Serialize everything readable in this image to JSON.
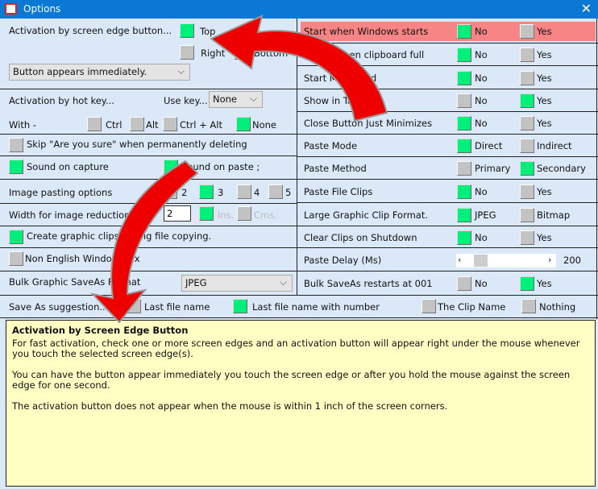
{
  "window": {
    "title": "Options",
    "close": "✕"
  },
  "left": {
    "edge": {
      "label": "Activation by screen edge button...",
      "top": "Top",
      "right": "Right",
      "bottom": "Bottom",
      "dropdown": "Button appears immediately."
    },
    "hotkey": {
      "label": "Activation by hot key...",
      "use_key": "Use key...",
      "key_value": "None",
      "with": "With  -",
      "ctrl": "Ctrl",
      "alt": "Alt",
      "ctrl_alt": "Ctrl + Alt",
      "none": "None"
    },
    "skip": "Skip \"Are you sure\" when permanently deleting",
    "sound_capture": "Sound on capture",
    "sound_paste": "Sound on paste ;",
    "image_paste": {
      "label": "Image pasting options",
      "opts": [
        "2",
        "3",
        "4",
        "5"
      ]
    },
    "width": {
      "label": "Width for image reduction",
      "value": "2",
      "ins": "Ins.",
      "cms": "Cms."
    },
    "create_graphic": "Create graphic clips during file copying.",
    "non_english": "Non English Windows Fix",
    "bulk": {
      "label": "Bulk Graphic SaveAs Format",
      "value": "JPEG"
    }
  },
  "right": [
    {
      "label": "Start when Windows starts",
      "a": "No",
      "b": "Yes",
      "on": "a",
      "highlight": "#f78585"
    },
    {
      "label": "Sound when clipboard full",
      "a": "No",
      "b": "Yes",
      "on": "a"
    },
    {
      "label": "Start Minimized",
      "a": "No",
      "b": "Yes",
      "on": "a"
    },
    {
      "label": "Show in Task Bar",
      "a": "No",
      "b": "Yes",
      "on": "b"
    },
    {
      "label": "Close Button Just Minimizes",
      "a": "No",
      "b": "Yes",
      "on": "a"
    },
    {
      "label": "Paste Mode",
      "a": "Direct",
      "b": "Indirect",
      "on": "a"
    },
    {
      "label": "Paste Method",
      "a": "Primary",
      "b": "Secondary",
      "on": "b"
    },
    {
      "label": "Paste File Clips",
      "a": "No",
      "b": "Yes",
      "on": "a"
    },
    {
      "label": "Large Graphic Clip Format.",
      "a": "JPEG",
      "b": "Bitmap",
      "on": "a"
    },
    {
      "label": "Clear Clips on Shutdown",
      "a": "No",
      "b": "Yes",
      "on": "a"
    },
    {
      "label": "Paste Delay (Ms)",
      "slider": true,
      "value": "200",
      "level": 0.05
    },
    {
      "label": "Bulk SaveAs restarts at 001",
      "a": "No",
      "b": "Yes",
      "on": "b"
    }
  ],
  "saveas": {
    "label": "Save As suggestion...",
    "opts": [
      "Last file name",
      "Last file name with number",
      "The Clip Name",
      "Nothing"
    ],
    "selected": 1
  },
  "help": {
    "title": "Activation by Screen Edge Button",
    "paragraphs": [
      "For fast activation, check one or more screen edges and an activation button will appear right under the mouse whenever you touch the selected screen edge(s).",
      "You can have the button appear immediately you touch the screen edge or after you hold the mouse against the screen edge for one second.",
      "The activation button does not appear when the mouse is within 1 inch of the screen corners."
    ]
  },
  "colors": {
    "checked": "#00ee7a",
    "unchecked": "#c3c3c3",
    "highlight": "#f78585",
    "help_bg": "#ffffc3",
    "titlebar": "#0a78d4"
  }
}
